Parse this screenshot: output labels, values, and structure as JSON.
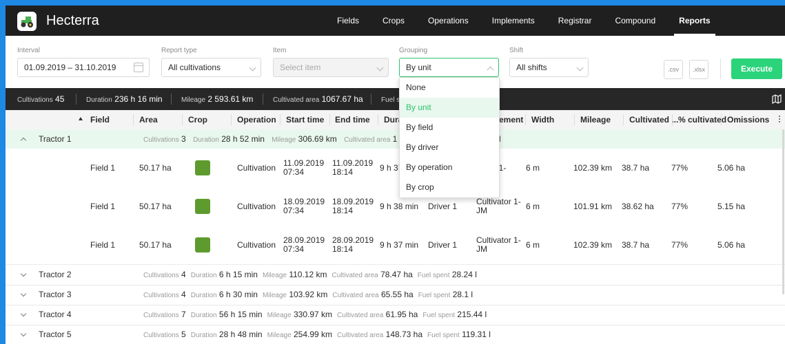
{
  "app": {
    "title": "Hecterra"
  },
  "nav": [
    "Fields",
    "Crops",
    "Operations",
    "Implements",
    "Registrar",
    "Compound",
    "Reports"
  ],
  "filters": {
    "interval": {
      "label": "Interval",
      "value": "01.09.2019 – 31.10.2019"
    },
    "report_type": {
      "label": "Report type",
      "value": "All cultivations"
    },
    "item": {
      "label": "Item",
      "placeholder": "Select item"
    },
    "grouping": {
      "label": "Grouping",
      "value": "By unit",
      "options": [
        "None",
        "By unit",
        "By field",
        "By driver",
        "By operation",
        "By crop"
      ]
    },
    "shift": {
      "label": "Shift",
      "value": "All shifts"
    },
    "csv_label": ".csv",
    "xlsx_label": ".xlsx",
    "execute_label": "Execute"
  },
  "summary": {
    "cultivations": {
      "label": "Cultivations",
      "value": "45"
    },
    "duration": {
      "label": "Duration",
      "value": "236 h 16 min"
    },
    "mileage": {
      "label": "Mileage",
      "value": "2 593.61 km"
    },
    "area": {
      "label": "Cultivated area",
      "value": "1067.67 ha"
    },
    "fuel": {
      "label": "Fuel sp"
    }
  },
  "columns": [
    "Field",
    "Area",
    "Crop",
    "Operation",
    "Start time",
    "End time",
    "Dura",
    "ement",
    "Width",
    "Mileage",
    "Cultivated ...",
    "% cultivated",
    "Omissions"
  ],
  "group_labels": {
    "cultivations": "Cultivations",
    "duration": "Duration",
    "mileage": "Mileage",
    "area": "Cultivated area",
    "fuel": "Fuel spent"
  },
  "tractor1": {
    "name": "Tractor 1",
    "cultivations": "3",
    "duration": "28 h 52 min",
    "mileage": "306.69 km",
    "area_partial": "1",
    "fuel_partial": "l"
  },
  "rows": [
    {
      "field": "Field 1",
      "area": "50.17 ha",
      "operation": "Cultivation",
      "start": "11.09.2019 07:34",
      "end": "11.09.2019 18:14",
      "duration": "9 h 37",
      "driver": "",
      "implement": "ivator 1-",
      "width": "6 m",
      "mileage": "102.39 km",
      "cultivated": "38.7 ha",
      "percent": "77%",
      "omissions": "5.06 ha"
    },
    {
      "field": "Field 1",
      "area": "50.17 ha",
      "operation": "Cultivation",
      "start": "18.09.2019 07:34",
      "end": "18.09.2019 18:14",
      "duration": "9 h 38 min",
      "driver": "Driver 1",
      "implement": "Cultivator 1-JM",
      "width": "6 m",
      "mileage": "101.91 km",
      "cultivated": "38.62 ha",
      "percent": "77%",
      "omissions": "5.15 ha"
    },
    {
      "field": "Field 1",
      "area": "50.17 ha",
      "operation": "Cultivation",
      "start": "28.09.2019 07:34",
      "end": "28.09.2019 18:14",
      "duration": "9 h 37 min",
      "driver": "Driver 1",
      "implement": "Cultivator 1-JM",
      "width": "6 m",
      "mileage": "102.39 km",
      "cultivated": "38.7 ha",
      "percent": "77%",
      "omissions": "5.06 ha"
    }
  ],
  "groups": [
    {
      "name": "Tractor 2",
      "cultivations": "4",
      "duration": "6 h 15 min",
      "mileage": "110.12 km",
      "area": "78.47 ha",
      "fuel": "28.24 l"
    },
    {
      "name": "Tractor 3",
      "cultivations": "4",
      "duration": "6 h 30 min",
      "mileage": "103.92 km",
      "area": "65.55 ha",
      "fuel": "28.1 l"
    },
    {
      "name": "Tractor 4",
      "cultivations": "7",
      "duration": "56 h 15 min",
      "mileage": "330.97 km",
      "area": "61.95 ha",
      "fuel": "215.44 l"
    },
    {
      "name": "Tractor 5",
      "cultivations": "5",
      "duration": "28 h 48 min",
      "mileage": "254.99 km",
      "area": "148.73 ha",
      "fuel": "119.31 l"
    }
  ],
  "colors": {
    "accent": "#2cc36b",
    "button": "#2bd37a",
    "header": "#1f1f1f",
    "summary": "#272727",
    "frame": "#1e88e5",
    "crop": "#5e9b2e"
  }
}
